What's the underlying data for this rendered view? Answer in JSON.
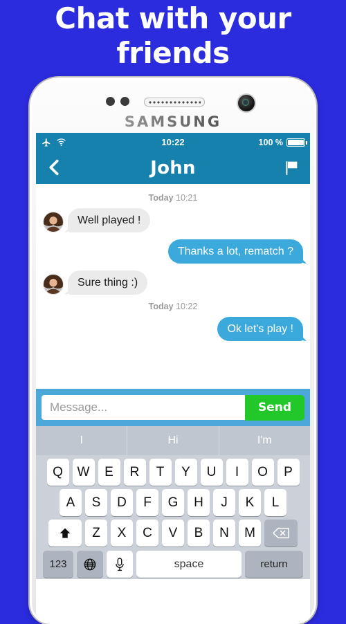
{
  "promo": {
    "headline_line1": "Chat with your",
    "headline_line2": "friends",
    "background_color": "#2c2cdf"
  },
  "device": {
    "brand": "SAMSUNG"
  },
  "status_bar": {
    "airplane_icon": "airplane-icon",
    "wifi_icon": "wifi-icon",
    "time": "10:22",
    "battery_percent": "100 %",
    "battery_icon": "battery-full-icon",
    "background_color": "#1781ad"
  },
  "nav_bar": {
    "back_icon": "chevron-left-icon",
    "title": "John",
    "flag_icon": "flag-icon"
  },
  "chat": {
    "messages": [
      {
        "type": "daystamp",
        "day": "Today",
        "time": "10:21"
      },
      {
        "type": "received",
        "text": "Well played !",
        "avatar": "avatar-john"
      },
      {
        "type": "sent",
        "text": "Thanks a lot, rematch ?"
      },
      {
        "type": "received",
        "text": "Sure thing :)",
        "avatar": "avatar-john"
      },
      {
        "type": "daystamp",
        "day": "Today",
        "time": "10:22"
      },
      {
        "type": "sent",
        "text": "Ok let's play !"
      }
    ],
    "bubble_sent_color": "#3ba9dc",
    "bubble_received_color": "#ebebeb"
  },
  "composer": {
    "placeholder": "Message...",
    "value": "",
    "send_label": "Send",
    "send_color": "#22c82a",
    "bar_color": "#4ba8d8"
  },
  "keyboard": {
    "suggestions": [
      "I",
      "Hi",
      "I'm"
    ],
    "row1": [
      "Q",
      "W",
      "E",
      "R",
      "T",
      "Y",
      "U",
      "I",
      "O",
      "P"
    ],
    "row2": [
      "A",
      "S",
      "D",
      "F",
      "G",
      "H",
      "J",
      "K",
      "L"
    ],
    "row3": [
      "Z",
      "X",
      "C",
      "V",
      "B",
      "N",
      "M"
    ],
    "shift_icon": "shift-up-arrow-icon",
    "backspace_icon": "backspace-delete-icon",
    "numeric_label": "123",
    "globe_icon": "globe-language-icon",
    "mic_icon": "microphone-icon",
    "space_label": "space",
    "return_label": "return"
  }
}
